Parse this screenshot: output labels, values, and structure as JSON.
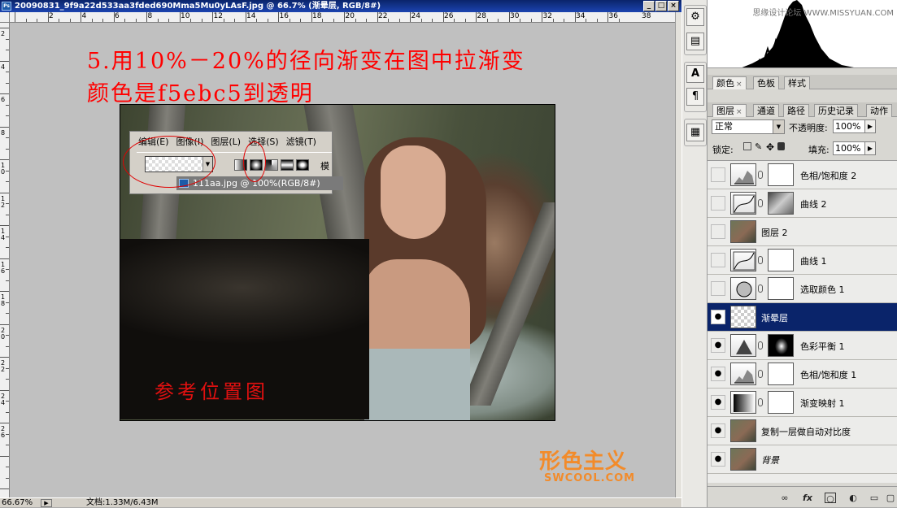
{
  "window": {
    "title": "20090831_9f9a22d533aa3fded690Mma5Mu0yLAsF.jpg @ 66.7% (渐晕层, RGB/8#)",
    "app_icon": "photoshop-icon",
    "buttons": [
      "minimize",
      "maximize",
      "close"
    ]
  },
  "ruler": {
    "h_numbers": [
      "2",
      "4",
      "6",
      "8",
      "10",
      "12",
      "14",
      "16",
      "18",
      "20",
      "22",
      "24",
      "26",
      "28",
      "30",
      "32",
      "34",
      "36",
      "38"
    ],
    "v_numbers": [
      "2",
      "4",
      "6",
      "8",
      "10",
      "12",
      "14",
      "16",
      "18",
      "20",
      "22",
      "24",
      "26"
    ]
  },
  "caption": {
    "line1": "5.用10%－20%的径向渐变在图中拉渐变",
    "line2": "颜色是f5ebc5到透明"
  },
  "inset": {
    "menu": [
      "编辑(E)",
      "图像(I)",
      "图层(L)",
      "选择(S)",
      "滤镜(T)"
    ],
    "gradient_types": [
      "linear",
      "radial",
      "angle",
      "reflected",
      "diamond"
    ],
    "selected_type": "radial",
    "mode_label": "模",
    "doc_tab": "111aa.jpg @ 100%(RGB/8#)"
  },
  "reference_box": {
    "label": "参考位置图"
  },
  "logo": {
    "line1": "形色主义",
    "line2": "SWCOOL.COM"
  },
  "status": {
    "zoom": "66.67%",
    "doc_info": "文档:1.33M/6.43M"
  },
  "histogram": {
    "watermark": "思缘设计论坛 WWW.MISSYUAN.COM"
  },
  "panel_tabs": {
    "color_row": [
      {
        "label": "颜色",
        "active": true,
        "close": "×"
      },
      {
        "label": "色板",
        "active": false
      },
      {
        "label": "样式",
        "active": false
      }
    ],
    "layers_row": [
      {
        "label": "图层",
        "active": true,
        "close": "×"
      },
      {
        "label": "通道",
        "active": false
      },
      {
        "label": "路径",
        "active": false
      },
      {
        "label": "历史记录",
        "active": false
      },
      {
        "label": "动作",
        "active": false
      }
    ]
  },
  "layers_panel": {
    "blend_mode": "正常",
    "opacity_label": "不透明度:",
    "opacity": "100%",
    "lock_label": "锁定:",
    "fill_label": "填充:",
    "fill": "100%",
    "layers": [
      {
        "name": "色相/饱和度 2",
        "visible": false,
        "thumb": "adj-hue",
        "mask": "white",
        "italic": false,
        "selected": false
      },
      {
        "name": "曲线 2",
        "visible": false,
        "thumb": "adj-curve",
        "mask": "curv",
        "italic": false,
        "selected": false
      },
      {
        "name": "图层 2",
        "visible": false,
        "thumb": "photo",
        "mask": "",
        "italic": false,
        "selected": false
      },
      {
        "name": "曲线 1",
        "visible": false,
        "thumb": "adj-curve",
        "mask": "white",
        "italic": false,
        "selected": false
      },
      {
        "name": "选取颜色 1",
        "visible": false,
        "thumb": "adj-selcolor",
        "mask": "white",
        "italic": false,
        "selected": false
      },
      {
        "name": "渐晕层",
        "visible": true,
        "thumb": "trans",
        "mask": "",
        "italic": false,
        "selected": true
      },
      {
        "name": "色彩平衡 1",
        "visible": true,
        "thumb": "adj-balance",
        "mask": "dark",
        "italic": false,
        "selected": false
      },
      {
        "name": "色相/饱和度 1",
        "visible": true,
        "thumb": "adj-hue",
        "mask": "white",
        "italic": false,
        "selected": false
      },
      {
        "name": "渐变映射 1",
        "visible": true,
        "thumb": "adj-gradmap",
        "mask": "white",
        "italic": false,
        "selected": false
      },
      {
        "name": "复制一层做自动对比度",
        "visible": true,
        "thumb": "photo",
        "mask": "",
        "italic": false,
        "selected": false
      },
      {
        "name": "背景",
        "visible": true,
        "thumb": "photo",
        "mask": "",
        "italic": true,
        "selected": false
      }
    ],
    "footer_icons": [
      "link-layers-icon",
      "fx-icon",
      "add-mask-icon",
      "adjustment-layer-icon",
      "new-group-icon",
      "new-layer-icon",
      "trash-icon"
    ],
    "footer_fx": "fx"
  },
  "colors": {
    "caption_red": "#ff0000",
    "selection_blue": "#0a246a",
    "logo_orange": "#f28b2a"
  }
}
